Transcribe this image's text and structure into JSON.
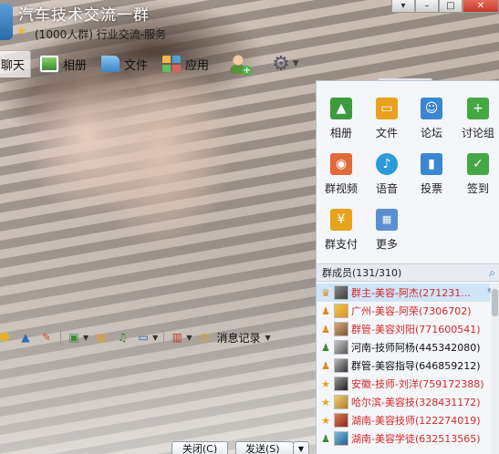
{
  "window": {
    "title": "汽车技术交流一群",
    "subtitle": "(1000人群) 行业交流-服务"
  },
  "toolbar": {
    "tabs": [
      {
        "label": "聊天",
        "icon": "chat-icon",
        "active": true
      },
      {
        "label": "相册",
        "icon": "album-icon",
        "active": false
      },
      {
        "label": "文件",
        "icon": "folder-icon",
        "active": false
      },
      {
        "label": "应用",
        "icon": "apps-icon",
        "active": false
      }
    ],
    "extra_icons": [
      "add-member-icon",
      "gear-icon"
    ]
  },
  "apps": [
    {
      "label": "相册",
      "icon": "album-icon",
      "color": "#3e9a3e"
    },
    {
      "label": "文件",
      "icon": "folder-icon",
      "color": "#e8a21c"
    },
    {
      "label": "论坛",
      "icon": "forum-icon",
      "color": "#3a86d0"
    },
    {
      "label": "讨论组",
      "icon": "discussion-icon",
      "color": "#45a845"
    },
    {
      "label": "群视频",
      "icon": "video-icon",
      "color": "#e06a3a"
    },
    {
      "label": "语音",
      "icon": "voice-icon",
      "color": "#2a9ad8"
    },
    {
      "label": "投票",
      "icon": "vote-icon",
      "color": "#3a86d0"
    },
    {
      "label": "签到",
      "icon": "checkin-icon",
      "color": "#45a845"
    },
    {
      "label": "群支付",
      "icon": "payment-icon",
      "color": "#e8a21c"
    },
    {
      "label": "更多",
      "icon": "more-icon",
      "color": "#5b8fd0"
    }
  ],
  "members": {
    "header": "群成员(131/310)",
    "list": [
      {
        "name": "群主-美容-阿杰(271231...",
        "role": "owner-icon",
        "color": "#d62828",
        "selected": true
      },
      {
        "name": "广州-美容-阿荣(7306702)",
        "role": "admin-icon",
        "color": "#d62828"
      },
      {
        "name": "群管-美容刘阳(771600541)",
        "role": "admin-icon",
        "color": "#d62828"
      },
      {
        "name": "河南-技师阿杨(445342080)",
        "role": "member-icon",
        "color": "#111111"
      },
      {
        "name": "群管-美容指导(646859212)",
        "role": "admin-icon",
        "color": "#111111"
      },
      {
        "name": "安徽-技师-刘洋(759172388)",
        "role": "star-icon",
        "color": "#d62828"
      },
      {
        "name": "哈尔滨-美容技(328431172)",
        "role": "star-icon",
        "color": "#d62828"
      },
      {
        "name": "湖南-美容技师(122274019)",
        "role": "star-icon",
        "color": "#d62828"
      },
      {
        "name": "湖南-美容学徒(632513565)",
        "role": "member-icon",
        "color": "#d62828"
      }
    ]
  },
  "input_toolbar": {
    "message_record": "消息记录"
  },
  "buttons": {
    "close": "关闭(C)",
    "send": "发送(S)"
  }
}
